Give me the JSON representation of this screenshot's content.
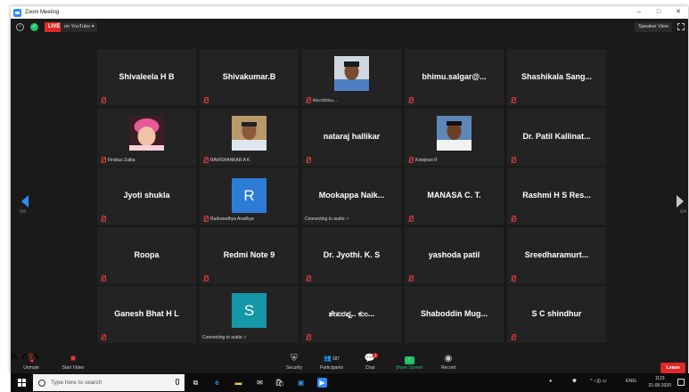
{
  "window": {
    "title": "Zoom Meeting",
    "controls": [
      "–",
      "□",
      "✕"
    ]
  },
  "topbar": {
    "live": "LIVE",
    "youtube": "on YouTube ▾",
    "speaker_view": "Speaker View"
  },
  "pager": {
    "left": "0/4",
    "right": "0/4"
  },
  "tiles": [
    {
      "name": "Shivaleela H B",
      "label": ""
    },
    {
      "name": "Shivakumar.B",
      "label": ""
    },
    {
      "name": "",
      "label": "ಶಿವಬಸವರಾಜ..."
    },
    {
      "name": "bhimu.salgar@...",
      "label": ""
    },
    {
      "name": "Shashikala Sang...",
      "label": ""
    },
    {
      "name": "",
      "label": "Firdous Zaiba"
    },
    {
      "name": "",
      "label": "RAVISHANKAR A K"
    },
    {
      "name": "nataraj hallikar",
      "label": ""
    },
    {
      "name": "",
      "label": "Kotojirao R"
    },
    {
      "name": "Dr. Patil Kallinat...",
      "label": ""
    },
    {
      "name": "Jyoti shukla",
      "label": ""
    },
    {
      "name": "",
      "label": "Rudraradhya Aradhya",
      "avatar": "R"
    },
    {
      "name": "Mookappa Naik...",
      "label": "Connecting to audio ✓"
    },
    {
      "name": "MANASA C. T.",
      "label": ""
    },
    {
      "name": "Rashmi H S Res...",
      "label": ""
    },
    {
      "name": "Roopa",
      "label": ""
    },
    {
      "name": "Redmi Note 9",
      "label": ""
    },
    {
      "name": "Dr. Jyothi. K. S",
      "label": ""
    },
    {
      "name": "yashoda patil",
      "label": ""
    },
    {
      "name": "Sreedharamurt...",
      "label": ""
    },
    {
      "name": "Ganesh Bhat  H L",
      "label": ""
    },
    {
      "name": "",
      "label": "Connecting to audio ✓",
      "avatar": "S"
    },
    {
      "name": "ಶೇಖರಪ್ಪ.. ಕುಂ...",
      "label": ""
    },
    {
      "name": "Shaboddin Mug...",
      "label": ""
    },
    {
      "name": "S C shindhur",
      "label": ""
    }
  ],
  "toolbar": {
    "unmute": "Unmute",
    "start_video": "Start Video",
    "security": "Security",
    "participants": "Participants",
    "participants_count": "187",
    "chat": "Chat",
    "chat_badge": "1",
    "share_screen": "Share Screen",
    "record": "Record",
    "leave": "Leave"
  },
  "taskbar": {
    "search_placeholder": "Type here to search",
    "lang": "ENG",
    "time": "1123",
    "date": "31-08-2020"
  },
  "colors": {
    "accent": "#2d8cff",
    "live": "#e02828",
    "share": "#23c16b"
  }
}
